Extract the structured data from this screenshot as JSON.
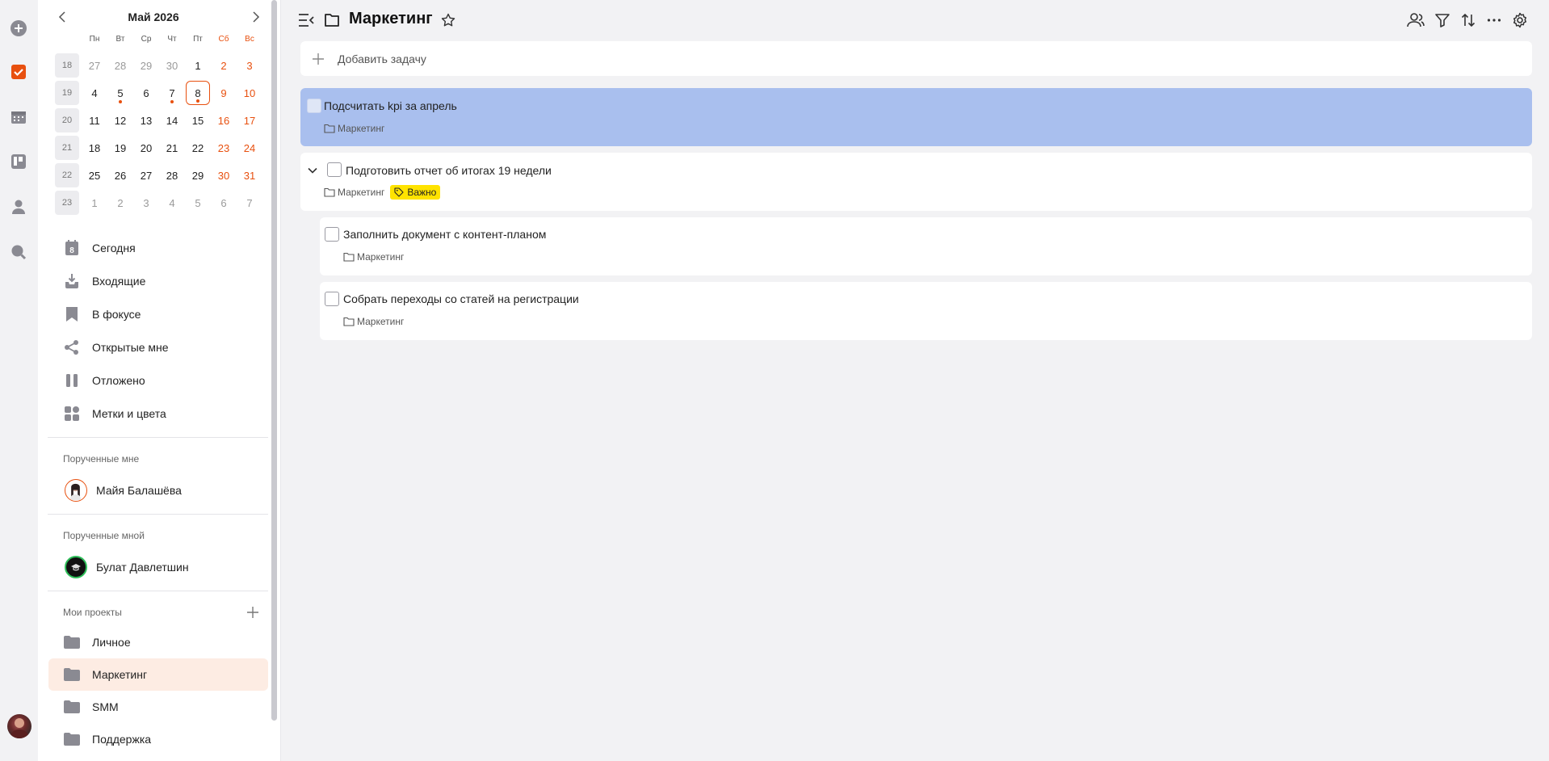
{
  "calendar": {
    "title": "Май 2026",
    "weekdays": [
      "Пн",
      "Вт",
      "Ср",
      "Чт",
      "Пт",
      "Сб",
      "Вс"
    ],
    "weeks": [
      {
        "num": "18",
        "days": [
          "27",
          "28",
          "29",
          "30",
          "1",
          "2",
          "3"
        ]
      },
      {
        "num": "19",
        "days": [
          "4",
          "5",
          "6",
          "7",
          "8",
          "9",
          "10"
        ]
      },
      {
        "num": "20",
        "days": [
          "11",
          "12",
          "13",
          "14",
          "15",
          "16",
          "17"
        ]
      },
      {
        "num": "21",
        "days": [
          "18",
          "19",
          "20",
          "21",
          "22",
          "23",
          "24"
        ]
      },
      {
        "num": "22",
        "days": [
          "25",
          "26",
          "27",
          "28",
          "29",
          "30",
          "31"
        ]
      },
      {
        "num": "23",
        "days": [
          "1",
          "2",
          "3",
          "4",
          "5",
          "6",
          "7"
        ]
      }
    ],
    "today": "8"
  },
  "nav": {
    "items": [
      {
        "label": "Сегодня",
        "icon": "calendar-today-icon"
      },
      {
        "label": "Входящие",
        "icon": "inbox-icon"
      },
      {
        "label": "В фокусе",
        "icon": "bookmark-icon"
      },
      {
        "label": "Открытые мне",
        "icon": "share-icon"
      },
      {
        "label": "Отложено",
        "icon": "pause-icon"
      },
      {
        "label": "Метки и цвета",
        "icon": "tags-grid-icon"
      }
    ]
  },
  "assigned_to_me": {
    "label": "Порученные мне",
    "people": [
      {
        "name": "Майя Балашёва"
      }
    ]
  },
  "assigned_by_me": {
    "label": "Порученные мной",
    "people": [
      {
        "name": "Булат Давлетшин"
      }
    ]
  },
  "projects": {
    "label": "Мои проекты",
    "items": [
      {
        "label": "Личное",
        "active": false
      },
      {
        "label": "Маркетинг",
        "active": true
      },
      {
        "label": "SMM",
        "active": false
      },
      {
        "label": "Поддержка",
        "active": false
      }
    ]
  },
  "header": {
    "title": "Маркетинг"
  },
  "add_task": {
    "placeholder": "Добавить задачу"
  },
  "tasks": [
    {
      "title": "Подсчитать kpi за апрель",
      "project": "Маркетинг",
      "selected": true
    },
    {
      "title": "Подготовить отчет об итогах 19 недели",
      "project": "Маркетинг",
      "tag": "Важно",
      "expanded": true
    },
    {
      "title": "Заполнить документ с контент-планом",
      "project": "Маркетинг",
      "subtask": true
    },
    {
      "title": "Собрать переходы со статей на регистрации",
      "project": "Маркетинг",
      "subtask": true
    }
  ],
  "colors": {
    "accent": "#e8500f",
    "selected_task": "#a9bfee",
    "active_project": "#fdece3",
    "tag": "#ffe300"
  }
}
